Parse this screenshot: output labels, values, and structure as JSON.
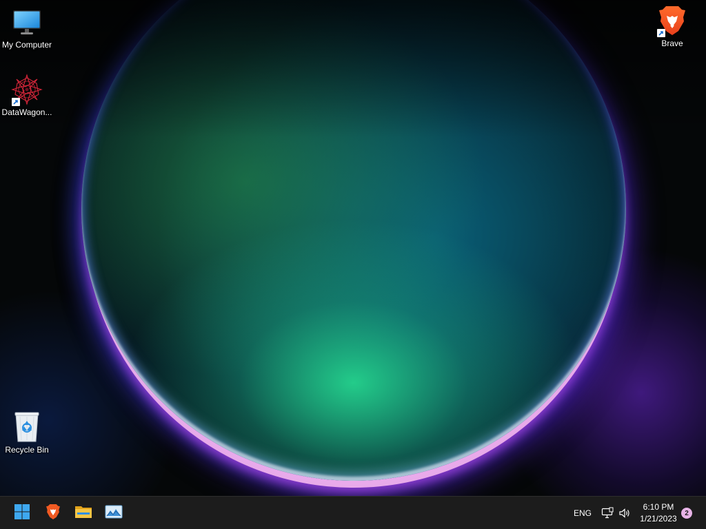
{
  "desktop": {
    "icons": [
      {
        "label": "My Computer",
        "icon": "monitor-icon"
      },
      {
        "label": "DataWagon...",
        "icon": "datawagon-app-icon",
        "shortcut": true
      },
      {
        "label": "Recycle Bin",
        "icon": "recycle-bin-icon"
      },
      {
        "label": "Brave",
        "icon": "brave-lion-icon",
        "shortcut": true
      }
    ]
  },
  "taskbar": {
    "pinned": [
      {
        "name": "Start",
        "icon": "windows-logo-icon"
      },
      {
        "name": "Brave",
        "icon": "brave-lion-icon"
      },
      {
        "name": "File Explorer",
        "icon": "folder-icon"
      },
      {
        "name": "Image viewer",
        "icon": "photo-icon"
      }
    ],
    "tray": {
      "language": "ENG",
      "network_icon": "network-icon",
      "volume_icon": "speaker-icon",
      "time": "6:10 PM",
      "date": "1/21/2023",
      "notification_count": "2"
    }
  },
  "colors": {
    "taskbar_bg": "#1c1c1c",
    "accent_blue": "#3ea8f0",
    "brave_orange": "#f15a22",
    "notification_badge": "#e7b3e6"
  }
}
